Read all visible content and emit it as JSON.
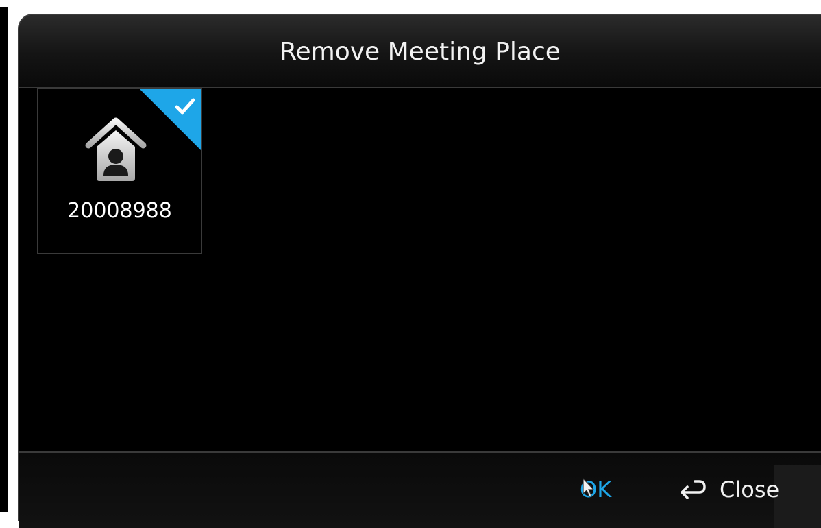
{
  "dialog": {
    "title": "Remove Meeting Place",
    "tiles": [
      {
        "label": "20008988",
        "selected": true,
        "icon": "home-person-icon"
      }
    ],
    "footer": {
      "ok_label": "OK",
      "close_label": "Close",
      "close_icon": "return-arrow-icon"
    }
  },
  "colors": {
    "accent": "#1ea6e8",
    "background": "#000000",
    "text": "#f2f2f2"
  }
}
